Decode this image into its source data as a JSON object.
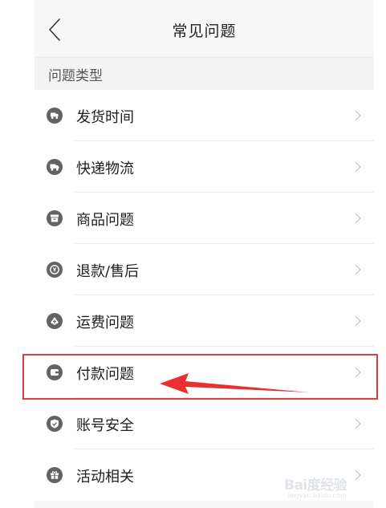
{
  "header": {
    "title": "常见问题"
  },
  "section": {
    "title": "问题类型"
  },
  "items": [
    {
      "label": "发货时间",
      "icon": "truck-clock-icon"
    },
    {
      "label": "快递物流",
      "icon": "delivery-truck-icon"
    },
    {
      "label": "商品问题",
      "icon": "box-icon"
    },
    {
      "label": "退款/售后",
      "icon": "refund-icon"
    },
    {
      "label": "运费问题",
      "icon": "shipping-fee-icon"
    },
    {
      "label": "付款问题",
      "icon": "wallet-icon"
    },
    {
      "label": "账号安全",
      "icon": "shield-check-icon"
    },
    {
      "label": "活动相关",
      "icon": "gift-icon"
    }
  ],
  "watermark": {
    "main": "Bai度经验",
    "sub": "jingyan.baidu.com"
  },
  "colors": {
    "icon": "#636363",
    "highlight": "#e23d3d",
    "chevron": "#c4c4c4"
  }
}
